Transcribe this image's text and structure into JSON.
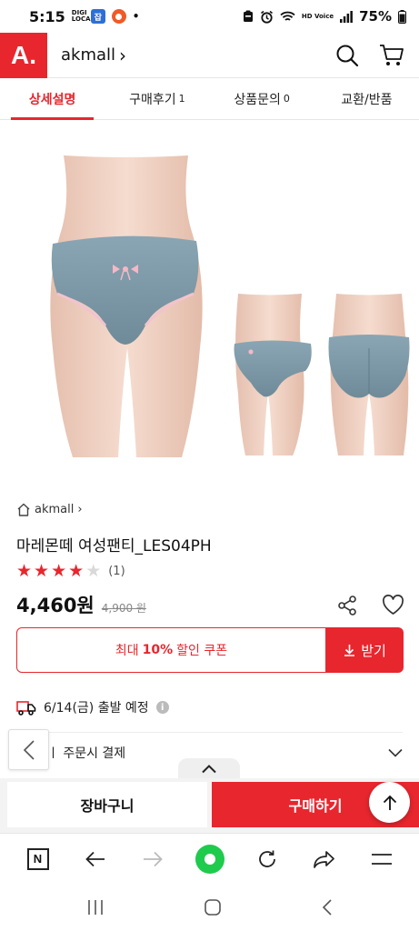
{
  "status_bar": {
    "time": "5:15",
    "digi_tag": "DIGI LOCA",
    "app_badge": "잡",
    "dot": "•",
    "hd_tag": "HD Voice",
    "battery": "75%"
  },
  "header": {
    "logo": "A.",
    "brand": "akmall",
    "brand_arrow": "›"
  },
  "tabs": [
    {
      "label": "상세설명",
      "count": ""
    },
    {
      "label": "구매후기",
      "count": "1"
    },
    {
      "label": "상품문의",
      "count": "0"
    },
    {
      "label": "교환/반품",
      "count": ""
    }
  ],
  "product": {
    "seller": "akmall",
    "seller_arrow": "›",
    "title": "마레몬떼 여성팬티_LES04PH",
    "rating": 4,
    "rating_max": 5,
    "rating_count": "(1)",
    "price": "4,460원",
    "original_price": "4,900 원"
  },
  "coupon": {
    "prefix": "최대",
    "percent": "10%",
    "suffix": "할인 쿠폰",
    "button": "받기"
  },
  "shipping": {
    "text": "6/14(금) 출발 예정",
    "info": "i"
  },
  "payment": {
    "text": "ㅣ 주문시 결제"
  },
  "bottom": {
    "cart": "장바구니",
    "buy": "구매하기"
  },
  "browser": {
    "n_label": "N"
  },
  "colors": {
    "accent": "#e8262e",
    "product_blue": "#7f99a6",
    "skin": "#efcfc0",
    "naver_green": "#1fcb4d"
  }
}
